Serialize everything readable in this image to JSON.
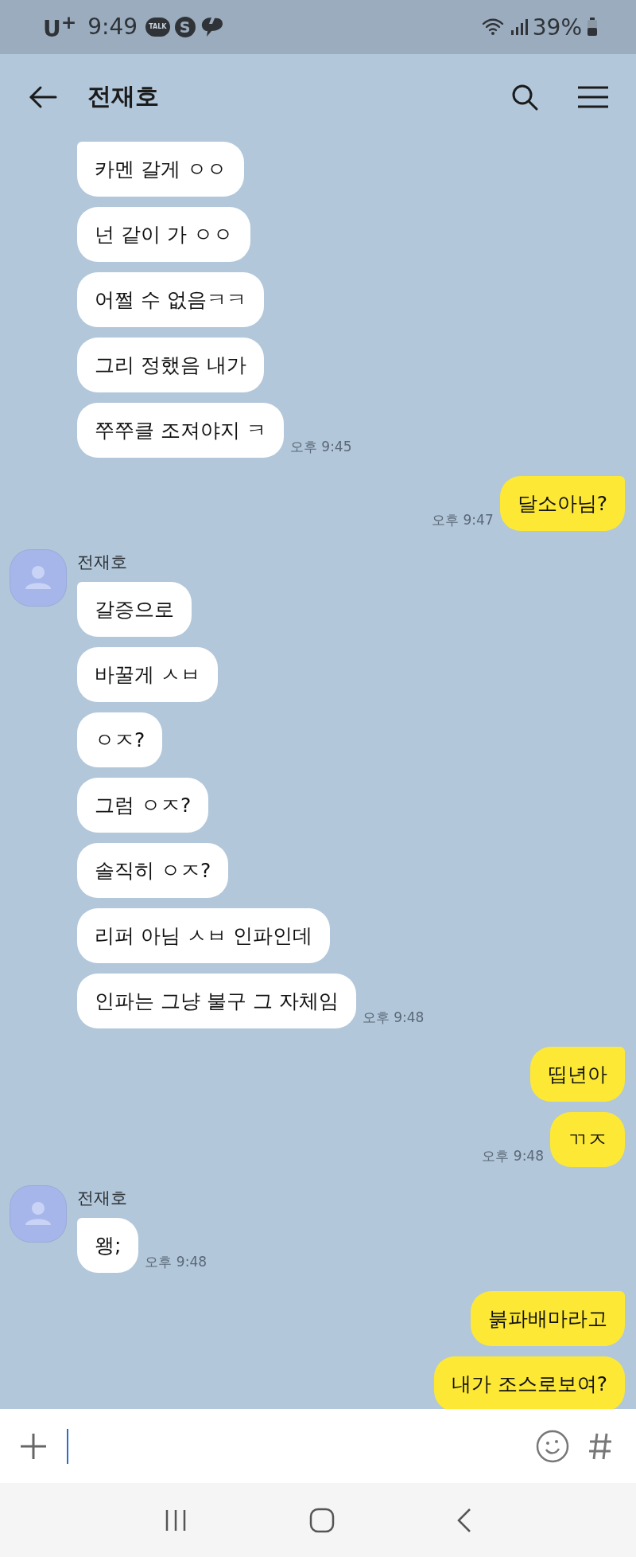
{
  "status_bar": {
    "carrier": "U$^{+}$",
    "time": "9:49",
    "notifications": [
      {
        "kind": "talk",
        "label": "TALK"
      },
      {
        "kind": "s",
        "label": "S"
      },
      {
        "kind": "swirl"
      }
    ],
    "battery": "39%"
  },
  "header": {
    "title": "전재호"
  },
  "groups": [
    {
      "kind": "received",
      "messages": [
        "카멘 갈게 ㅇㅇ",
        "넌 같이 가 ㅇㅇ",
        "어쩔 수 없음ㅋㅋ",
        "그리 정했음 내가",
        "쭈쭈클 조져야지 ㅋ"
      ],
      "time": "오후 9:45"
    },
    {
      "kind": "sent",
      "messages": [
        "달소아님?"
      ],
      "time": "오후 9:47"
    },
    {
      "kind": "received",
      "sender": "전재호",
      "messages": [
        "갈증으로",
        "바꿀게 ㅅㅂ",
        "ㅇㅈ?",
        "그럼 ㅇㅈ?",
        "솔직히 ㅇㅈ?",
        "리퍼 아님 ㅅㅂ 인파인데",
        "인파는 그냥 불구 그 자체임"
      ],
      "time": "오후 9:48"
    },
    {
      "kind": "sent",
      "messages": [
        "띱년아",
        "ㄲㅈ"
      ],
      "time": "오후 9:48"
    },
    {
      "kind": "received",
      "sender": "전재호",
      "messages": [
        "왱;"
      ],
      "time": "오후 9:48"
    },
    {
      "kind": "sent",
      "messages": [
        "붉파배마라고",
        "내가 조스로보여?"
      ]
    }
  ]
}
